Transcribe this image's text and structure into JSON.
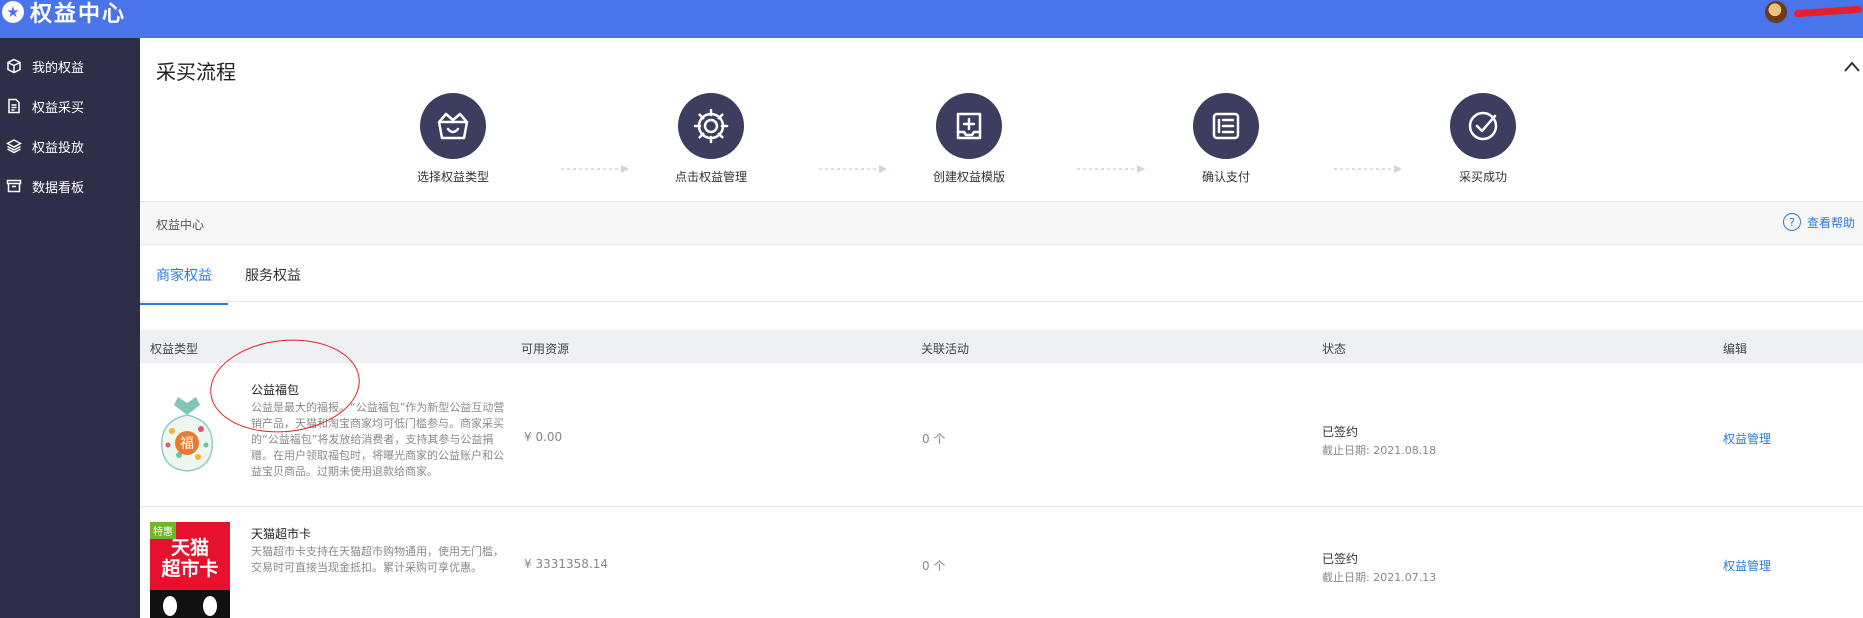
{
  "header": {
    "app_title": "权益中心"
  },
  "sidebar": {
    "items": [
      {
        "label": "我的权益",
        "icon": "cube-icon"
      },
      {
        "label": "权益采买",
        "icon": "document-icon"
      },
      {
        "label": "权益投放",
        "icon": "layers-icon"
      },
      {
        "label": "数据看板",
        "icon": "archive-icon"
      }
    ]
  },
  "process": {
    "title": "采买流程",
    "steps": [
      {
        "label": "选择权益类型",
        "icon": "basket-icon"
      },
      {
        "label": "点击权益管理",
        "icon": "gear-icon"
      },
      {
        "label": "创建权益模版",
        "icon": "add-template-icon"
      },
      {
        "label": "确认支付",
        "icon": "list-icon"
      },
      {
        "label": "采买成功",
        "icon": "check-circle-icon"
      }
    ]
  },
  "breadcrumb": {
    "text": "权益中心",
    "help_label": "查看帮助"
  },
  "tabs": [
    {
      "label": "商家权益",
      "active": true
    },
    {
      "label": "服务权益",
      "active": false
    }
  ],
  "table": {
    "columns": [
      "权益类型",
      "可用资源",
      "关联活动",
      "状态",
      "编辑"
    ],
    "rows": [
      {
        "name": "公益福包",
        "desc": "公益是最大的福报。“公益福包”作为新型公益互动营销产品，天猫和淘宝商家均可低门槛参与。商家采买的“公益福包”将发放给消费者，支持其参与公益捐赠。在用户领取福包时，将曝光商家的公益账户和公益宝贝商品。过期未使用退款给商家。",
        "resource": "¥ 0.00",
        "activity": "0 个",
        "status": "已签约",
        "deadline": "截止日期: 2021.08.18",
        "action": "权益管理",
        "thumb_text": "福"
      },
      {
        "name": "天猫超市卡",
        "desc": "天猫超市卡支持在天猫超市购物通用，使用无门槛，交易时可直接当现金抵扣。累计采购可享优惠。",
        "resource": "¥ 3331358.14",
        "activity": "0 个",
        "status": "已签约",
        "deadline": "截止日期: 2021.07.13",
        "action": "权益管理",
        "badge": "特惠",
        "thumb_text_1": "天猫",
        "thumb_text_2": "超市卡"
      }
    ]
  },
  "colors": {
    "topbar": "#4a74ea",
    "sidebar": "#2e2e48",
    "accent": "#2b7cd3",
    "step_circle": "#3d3d5f",
    "annotation": "#e5202a",
    "card_red": "#e8112d"
  }
}
